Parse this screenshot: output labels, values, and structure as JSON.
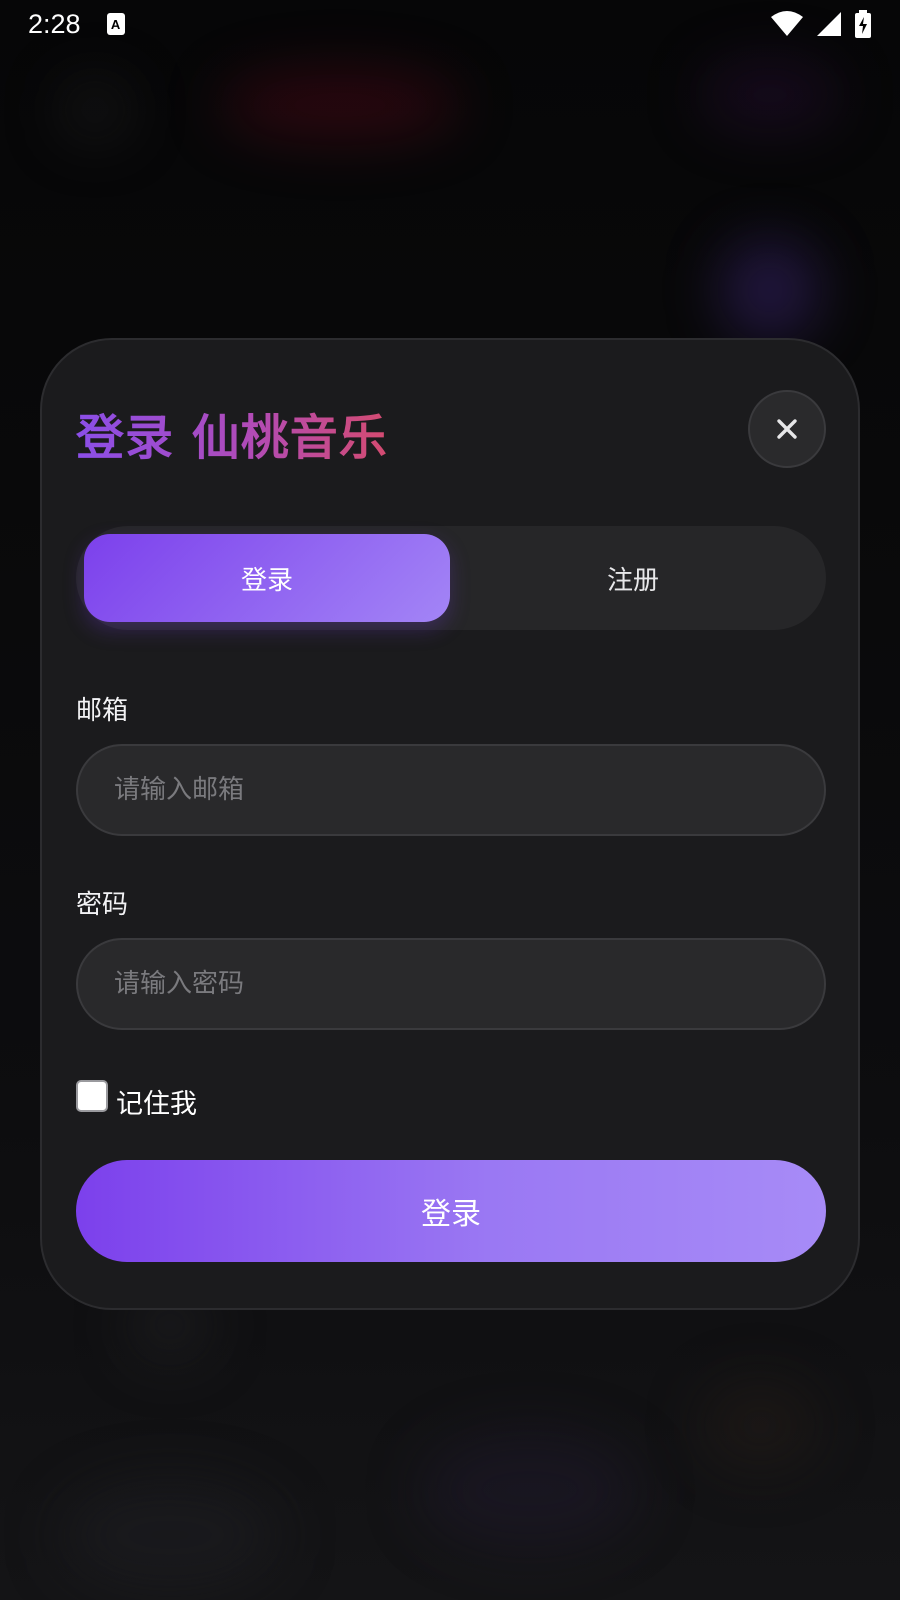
{
  "status_bar": {
    "time": "2:28",
    "notification_icon": "a-icon",
    "notification_letter": "A",
    "wifi_icon": "wifi-icon",
    "signal_icon": "signal-icon",
    "battery_icon": "battery-charging-icon"
  },
  "dialog": {
    "title": "登录 仙桃音乐",
    "close_icon": "close-icon",
    "close_glyph": "✕",
    "tabs": [
      {
        "label": "登录",
        "active": true
      },
      {
        "label": "注册",
        "active": false
      }
    ],
    "email": {
      "label": "邮箱",
      "placeholder": "请输入邮箱",
      "value": ""
    },
    "password": {
      "label": "密码",
      "placeholder": "请输入密码",
      "value": ""
    },
    "remember": {
      "label": "记住我",
      "checked": false
    },
    "submit_label": "登录"
  },
  "colors": {
    "accent_start": "#7c40ec",
    "accent_end": "#a78bf7",
    "title_gradient_start": "#8b4ee8",
    "title_gradient_end": "#d44b70",
    "dialog_background": "#1b1b1d",
    "page_background": "#070708"
  }
}
